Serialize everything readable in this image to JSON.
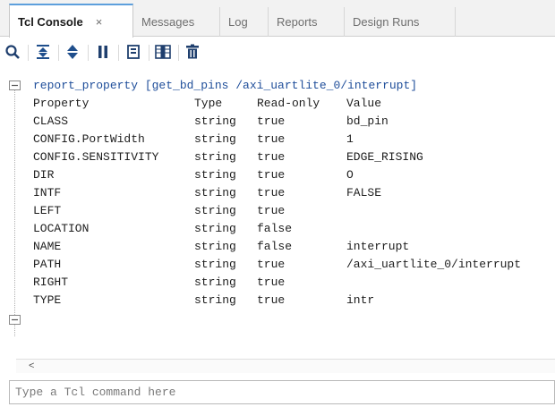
{
  "tabs": [
    {
      "label": "Tcl Console",
      "close": "×"
    },
    {
      "label": "Messages"
    },
    {
      "label": "Log"
    },
    {
      "label": "Reports"
    },
    {
      "label": "Design Runs"
    }
  ],
  "toolbar": {
    "icons": [
      "search-icon",
      "collapse-all-icon",
      "expand-all-icon",
      "pause-icon",
      "copy-icon",
      "columns-icon",
      "clear-icon"
    ],
    "accent": "#1f4e8c"
  },
  "console": {
    "command": "report_property [get_bd_pins /axi_uartlite_0/interrupt]",
    "header": {
      "property": "Property",
      "type": "Type",
      "readonly": "Read-only",
      "value": "Value"
    },
    "rows": [
      {
        "property": "CLASS",
        "type": "string",
        "readonly": "true",
        "value": "bd_pin"
      },
      {
        "property": "CONFIG.PortWidth",
        "type": "string",
        "readonly": "true",
        "value": "1"
      },
      {
        "property": "CONFIG.SENSITIVITY",
        "type": "string",
        "readonly": "true",
        "value": "EDGE_RISING"
      },
      {
        "property": "DIR",
        "type": "string",
        "readonly": "true",
        "value": "O"
      },
      {
        "property": "INTF",
        "type": "string",
        "readonly": "true",
        "value": "FALSE"
      },
      {
        "property": "LEFT",
        "type": "string",
        "readonly": "true",
        "value": ""
      },
      {
        "property": "LOCATION",
        "type": "string",
        "readonly": "false",
        "value": ""
      },
      {
        "property": "NAME",
        "type": "string",
        "readonly": "false",
        "value": "interrupt"
      },
      {
        "property": "PATH",
        "type": "string",
        "readonly": "true",
        "value": "/axi_uartlite_0/interrupt"
      },
      {
        "property": "RIGHT",
        "type": "string",
        "readonly": "true",
        "value": ""
      },
      {
        "property": "TYPE",
        "type": "string",
        "readonly": "true",
        "value": "intr"
      }
    ],
    "command_color": "#1f4e9a"
  },
  "scrollbar": {
    "left_arrow": "<"
  },
  "command_input": {
    "placeholder": "Type a Tcl command here",
    "value": ""
  }
}
